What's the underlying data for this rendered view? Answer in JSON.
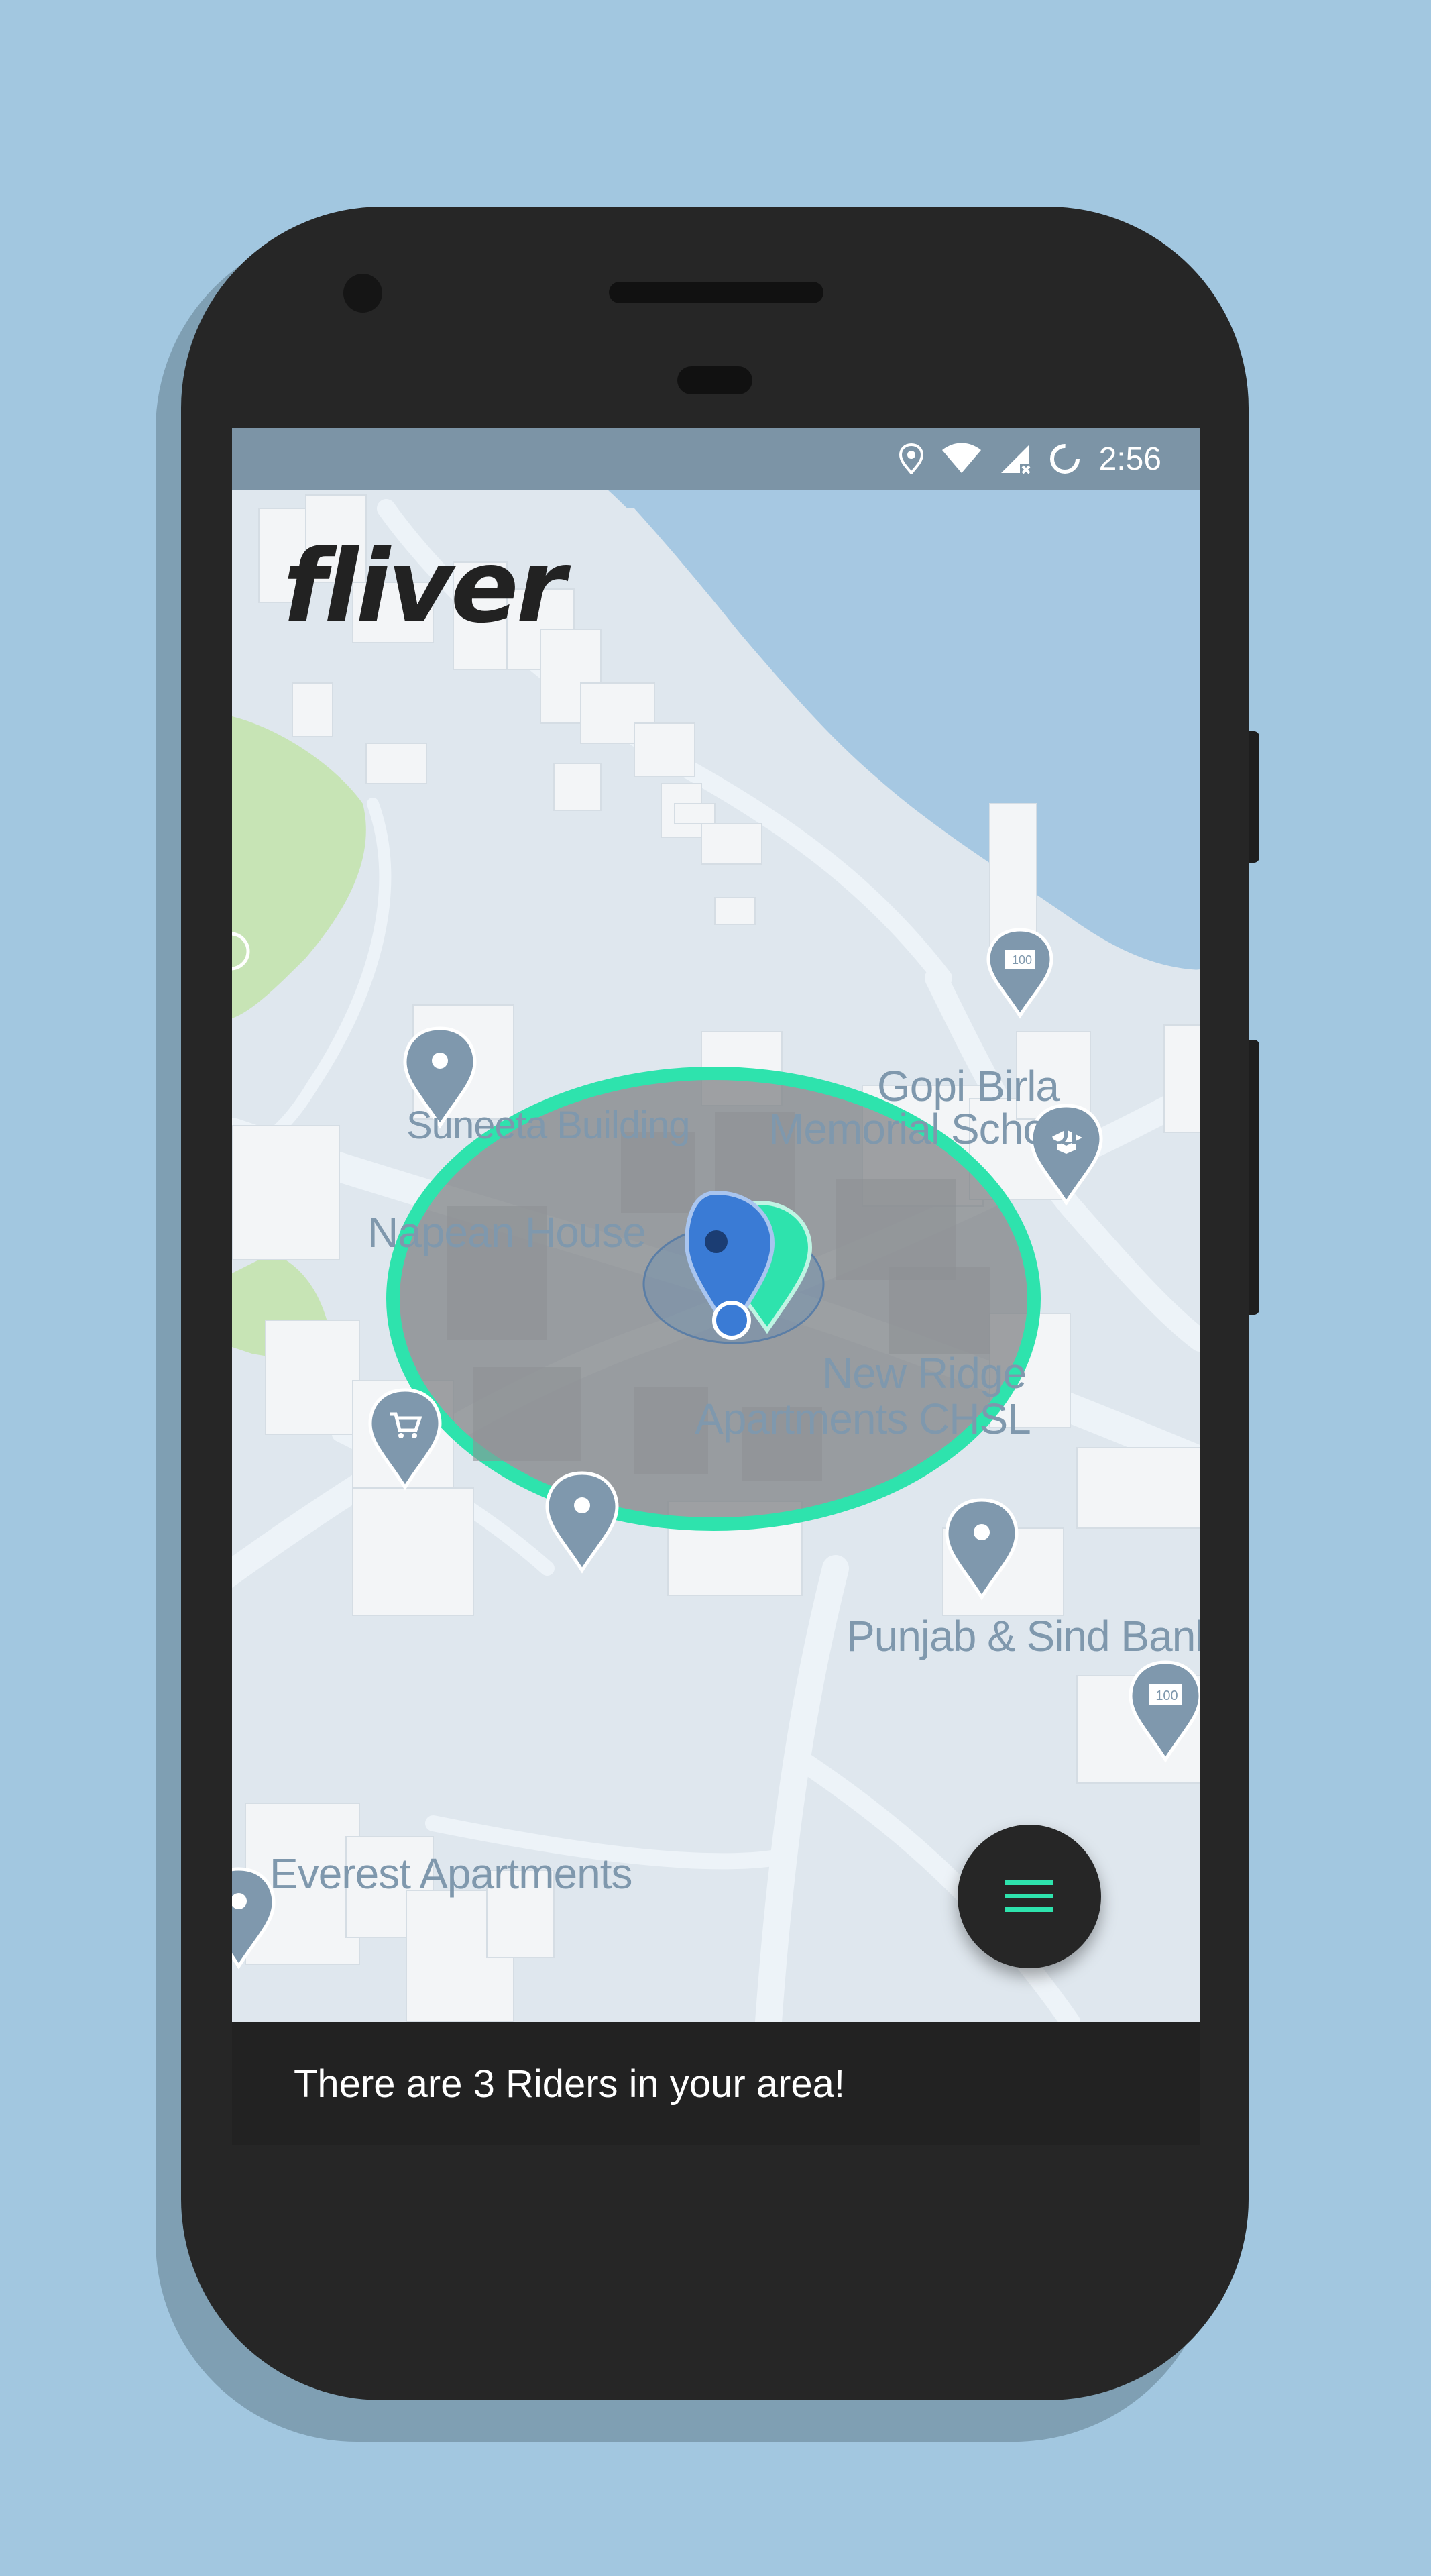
{
  "status_bar": {
    "time": "2:56",
    "icons": [
      "location-icon",
      "wifi-icon",
      "cell-signal-icon",
      "sync-icon"
    ]
  },
  "app": {
    "logo_text": "fliver"
  },
  "map": {
    "labels": {
      "gopi_birla_line1": "Gopi Birla",
      "gopi_birla_line2": "Memorial School",
      "suneeta": "Suneeta Building",
      "napean": "Napean House",
      "new_ridge_line1": "New Ridge",
      "new_ridge_line2": "Apartments CHSL",
      "punjab": "Punjab & Sind Bank",
      "everest": "Everest Apartments"
    },
    "atm_marker_text": "100",
    "search_area_color": "#2ee3ad",
    "user_pin_color": "#3a7bd5",
    "rider_pin_color": "#2ee3ad"
  },
  "fab": {
    "icon": "menu-icon"
  },
  "banner": {
    "text": "There are 3 Riders in your area!"
  }
}
